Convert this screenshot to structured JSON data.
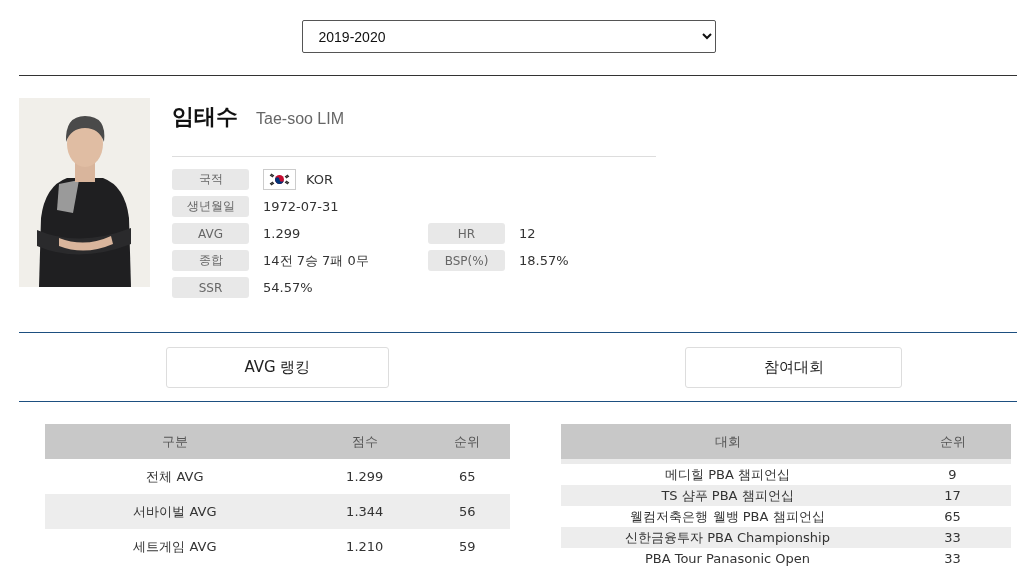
{
  "season_select": {
    "value": "2019-2020"
  },
  "player": {
    "name_ko": "임태수",
    "name_en": "Tae-soo LIM",
    "info_rows": [
      [
        {
          "label": "국적",
          "value": "KOR",
          "kind": "flag"
        }
      ],
      [
        {
          "label": "생년월일",
          "value": "1972-07-31",
          "kind": "text"
        }
      ],
      [
        {
          "label": "AVG",
          "value": "1.299",
          "kind": "text"
        },
        {
          "label": "HR",
          "value": "12",
          "kind": "text"
        }
      ],
      [
        {
          "label": "종합",
          "value": "14전 7승 7패 0무",
          "kind": "text"
        },
        {
          "label": "BSP(%)",
          "value": "18.57%",
          "kind": "text"
        }
      ],
      [
        {
          "label": "SSR",
          "value": "54.57%",
          "kind": "text"
        }
      ]
    ]
  },
  "section_buttons": [
    "AVG 랭킹",
    "참여대회"
  ],
  "avg_table": {
    "columns": [
      "구분",
      "점수",
      "순위"
    ],
    "rows": [
      [
        "전체 AVG",
        "1.299",
        "65"
      ],
      [
        "서바이벌 AVG",
        "1.344",
        "56"
      ],
      [
        "세트게임 AVG",
        "1.210",
        "59"
      ]
    ]
  },
  "tournament_table": {
    "columns": [
      "대회",
      "순위"
    ],
    "rows": [
      [
        "메디힐 PBA 챔피언십",
        "9"
      ],
      [
        "TS 샴푸 PBA 챔피언십",
        "17"
      ],
      [
        "웰컴저축은행 웰뱅 PBA 챔피언십",
        "65"
      ],
      [
        "신한금융투자 PBA Championship",
        "33"
      ],
      [
        "PBA Tour Panasonic Open",
        "33"
      ]
    ]
  }
}
